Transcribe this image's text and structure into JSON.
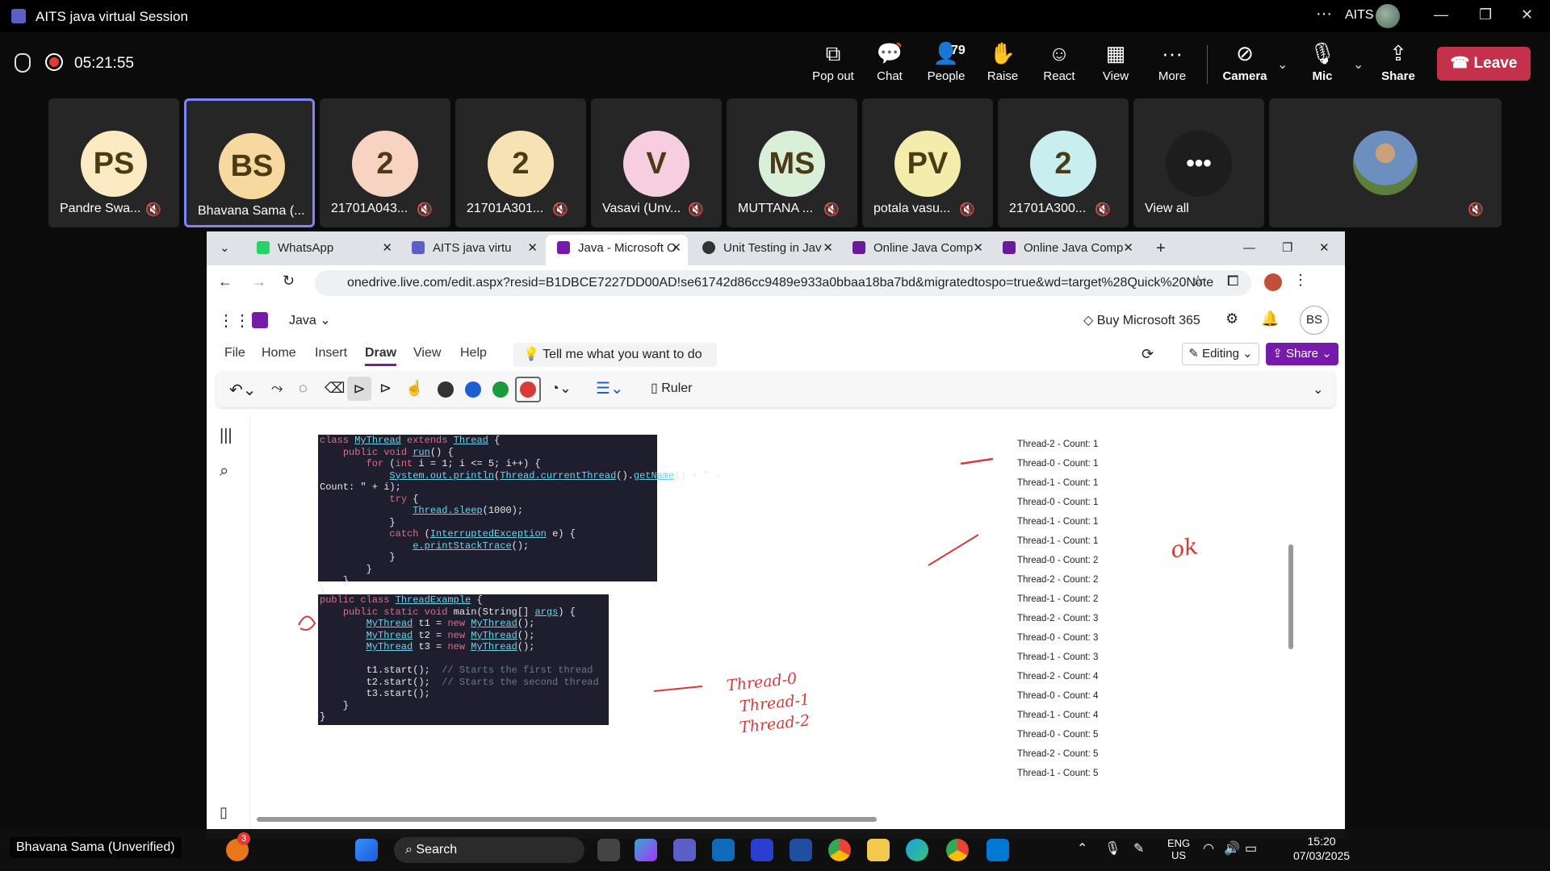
{
  "teams": {
    "window_title": "AITS java virtual Session",
    "org": "AITS",
    "timer": "05:21:55",
    "tools": [
      {
        "label": "Pop out",
        "icon": "pop-out-icon"
      },
      {
        "label": "Chat",
        "icon": "chat-icon"
      },
      {
        "label": "People",
        "icon": "people-icon",
        "count": "79"
      },
      {
        "label": "Raise",
        "icon": "raise-hand-icon"
      },
      {
        "label": "React",
        "icon": "react-icon"
      },
      {
        "label": "View",
        "icon": "view-icon"
      },
      {
        "label": "More",
        "icon": "more-icon"
      },
      {
        "label": "Camera",
        "icon": "camera-off-icon"
      },
      {
        "label": "Mic",
        "icon": "mic-off-icon"
      },
      {
        "label": "Share",
        "icon": "share-icon"
      }
    ],
    "leave_label": "Leave",
    "participants": [
      {
        "initials": "PS",
        "name": "Pandre Swa...",
        "color": "#fbeac2"
      },
      {
        "initials": "BS",
        "name": "Bhavana Sama (...",
        "color": "#f7d9a0"
      },
      {
        "initials": "2",
        "name": "21701A043...",
        "color": "#f9d3c2"
      },
      {
        "initials": "2",
        "name": "21701A301...",
        "color": "#f6e2b2"
      },
      {
        "initials": "V",
        "name": "Vasavi (Unv...",
        "color": "#f7cde0"
      },
      {
        "initials": "MS",
        "name": "MUTTANA ...",
        "color": "#d9efd8"
      },
      {
        "initials": "PV",
        "name": "potala vasu...",
        "color": "#f4ecaa"
      },
      {
        "initials": "2",
        "name": "21701A300...",
        "color": "#c8eef0"
      },
      {
        "initials": "•••",
        "name": "View all",
        "color": "#1d1d1d"
      }
    ],
    "presenter_label": "Bhavana Sama (Unverified)"
  },
  "browser": {
    "tabs": [
      {
        "title": "WhatsApp",
        "color": "#25d366"
      },
      {
        "title": "AITS java virtu",
        "color": "#5b5fc7"
      },
      {
        "title": "Java - Microsoft O",
        "color": "#7719aa"
      },
      {
        "title": "Unit Testing in Jav",
        "color": "#333333"
      },
      {
        "title": "Online Java Comp",
        "color": "#6a1b9a"
      },
      {
        "title": "Online Java Comp",
        "color": "#6a1b9a"
      }
    ],
    "url": "onedrive.live.com/edit.aspx?resid=B1DBCE7227DD00AD!se61742d86cc9489e933a0bbaa18ba7bd&migratedtospo=true&wd=target%28Quick%20Note"
  },
  "onenote": {
    "notebook": "Java",
    "buy_label": "Buy Microsoft 365",
    "user_initials": "BS",
    "menu": [
      "File",
      "Home",
      "Insert",
      "Draw",
      "View",
      "Help"
    ],
    "tell_me": "Tell me what you want to do",
    "editing_label": "Editing",
    "share_label": "Share",
    "ruler_label": "Ruler",
    "pen_colors": [
      "#333333",
      "#1f5ecf",
      "#1b9a3a",
      "#d83a3a"
    ],
    "output_lines": [
      "Thread-2 - Count: 1",
      "Thread-0 - Count: 1",
      "Thread-1 - Count: 1",
      "Thread-0 - Count: 1",
      "Thread-1 - Count: 1",
      "Thread-1 - Count: 1",
      "Thread-0 - Count: 2",
      "Thread-2 - Count: 2",
      "Thread-1 - Count: 2",
      "Thread-2 - Count: 3",
      "Thread-0 - Count: 3",
      "Thread-1 - Count: 3",
      "Thread-2 - Count: 4",
      "Thread-0 - Count: 4",
      "Thread-1 - Count: 4",
      "Thread-0 - Count: 5",
      "Thread-2 - Count: 5",
      "Thread-1 - Count: 5"
    ],
    "ink_notes": [
      "Thread-0",
      "Thread-1",
      "Thread-2",
      "ok"
    ]
  },
  "taskbar": {
    "search_label": "Search",
    "lang": "ENG",
    "region": "US",
    "time": "15:20",
    "date": "07/03/2025",
    "badge": "3"
  }
}
